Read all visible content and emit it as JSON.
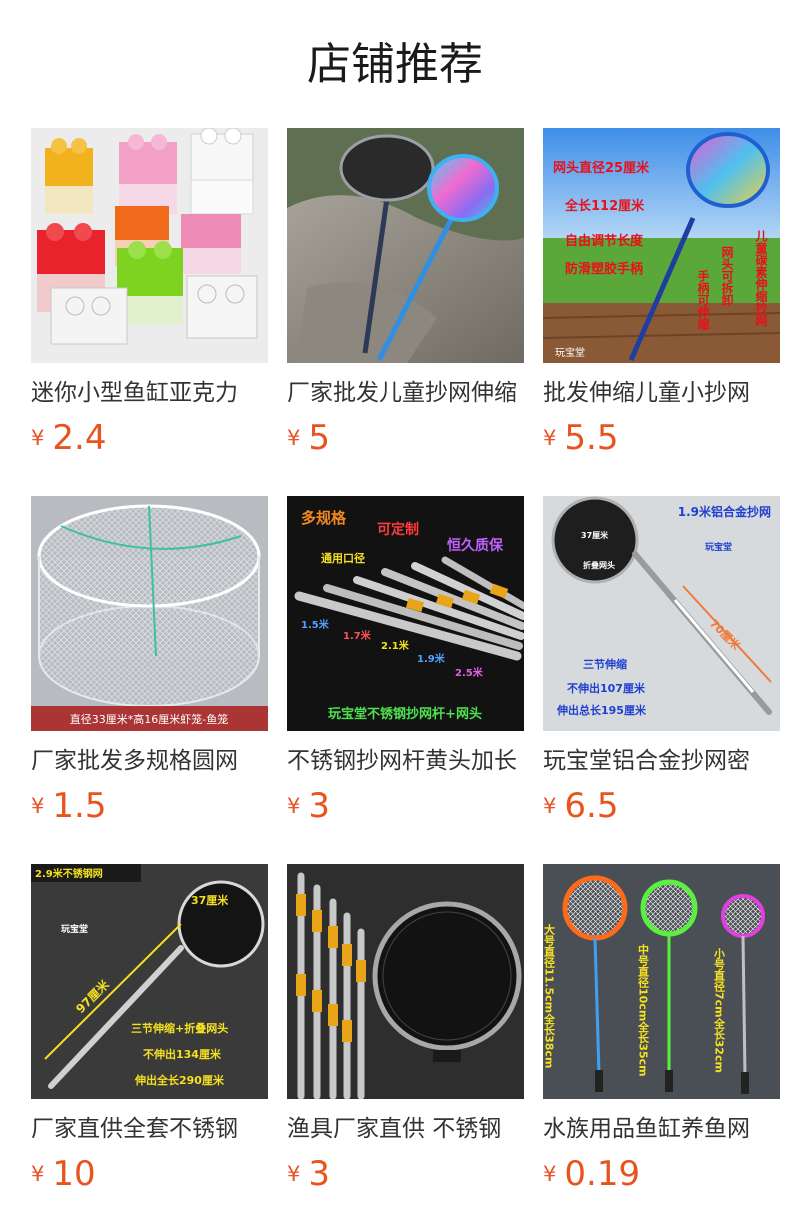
{
  "page": {
    "title": "店铺推荐"
  },
  "colors": {
    "price": "#e8541e"
  },
  "products": [
    {
      "title": "迷你小型鱼缸亚克力",
      "currency": "¥",
      "price": "2.4",
      "image": {
        "icon": "acrylic-fish-tanks-image",
        "texts": []
      }
    },
    {
      "title": "厂家批发儿童抄网伸缩",
      "currency": "¥",
      "price": "5",
      "image": {
        "icon": "kids-fishing-nets-image",
        "texts": []
      }
    },
    {
      "title": "批发伸缩儿童小抄网",
      "currency": "¥",
      "price": "5.5",
      "image": {
        "icon": "kids-net-on-grass-image",
        "texts": [
          "网头直径25厘米",
          "全长112厘米",
          "自由调节长度",
          "防滑塑胶手柄",
          "儿童碳素伸缩抄网",
          "网头可拆卸",
          "手柄可伸缩",
          "玩宝堂"
        ]
      }
    },
    {
      "title": "厂家批发多规格圆网",
      "currency": "¥",
      "price": "1.5",
      "image": {
        "icon": "round-shrimp-trap-image",
        "texts": [
          "直径33厘米*高16厘米虾笼-鱼笼"
        ]
      }
    },
    {
      "title": "不锈钢抄网杆黄头加长",
      "currency": "¥",
      "price": "3",
      "image": {
        "icon": "steel-net-poles-image",
        "texts": [
          "多规格",
          "可定制",
          "通用口径",
          "恒久质保",
          "1.5米",
          "1.7米",
          "2.1米",
          "1.9米",
          "2.5米",
          "玩宝堂不锈钢抄网杆+网头"
        ]
      }
    },
    {
      "title": "玩宝堂铝合金抄网密",
      "currency": "¥",
      "price": "6.5",
      "image": {
        "icon": "aluminum-landing-net-image",
        "texts": [
          "1.9米铝合金抄网",
          "37厘米",
          "折叠网头",
          "70厘米",
          "玩宝堂",
          "三节伸缩",
          "不伸出107厘米",
          "伸出总长195厘米"
        ]
      }
    },
    {
      "title": "厂家直供全套不锈钢",
      "currency": "¥",
      "price": "10",
      "image": {
        "icon": "steel-landing-net-image",
        "texts": [
          "2.9米不锈钢网",
          "37厘米",
          "97厘米",
          "玩宝堂",
          "三节伸缩+折叠网头",
          "不伸出134厘米",
          "伸出全长290厘米"
        ]
      }
    },
    {
      "title": "渔具厂家直供 不锈钢",
      "currency": "¥",
      "price": "3",
      "image": {
        "icon": "net-poles-and-net-image",
        "texts": []
      }
    },
    {
      "title": "水族用品鱼缸养鱼网",
      "currency": "¥",
      "price": "0.19",
      "image": {
        "icon": "aquarium-nets-image",
        "texts": [
          "大号直径11.5cm全长38cm",
          "中号直径10cm全长35cm",
          "小号直径7cm全长32cm"
        ]
      }
    }
  ]
}
